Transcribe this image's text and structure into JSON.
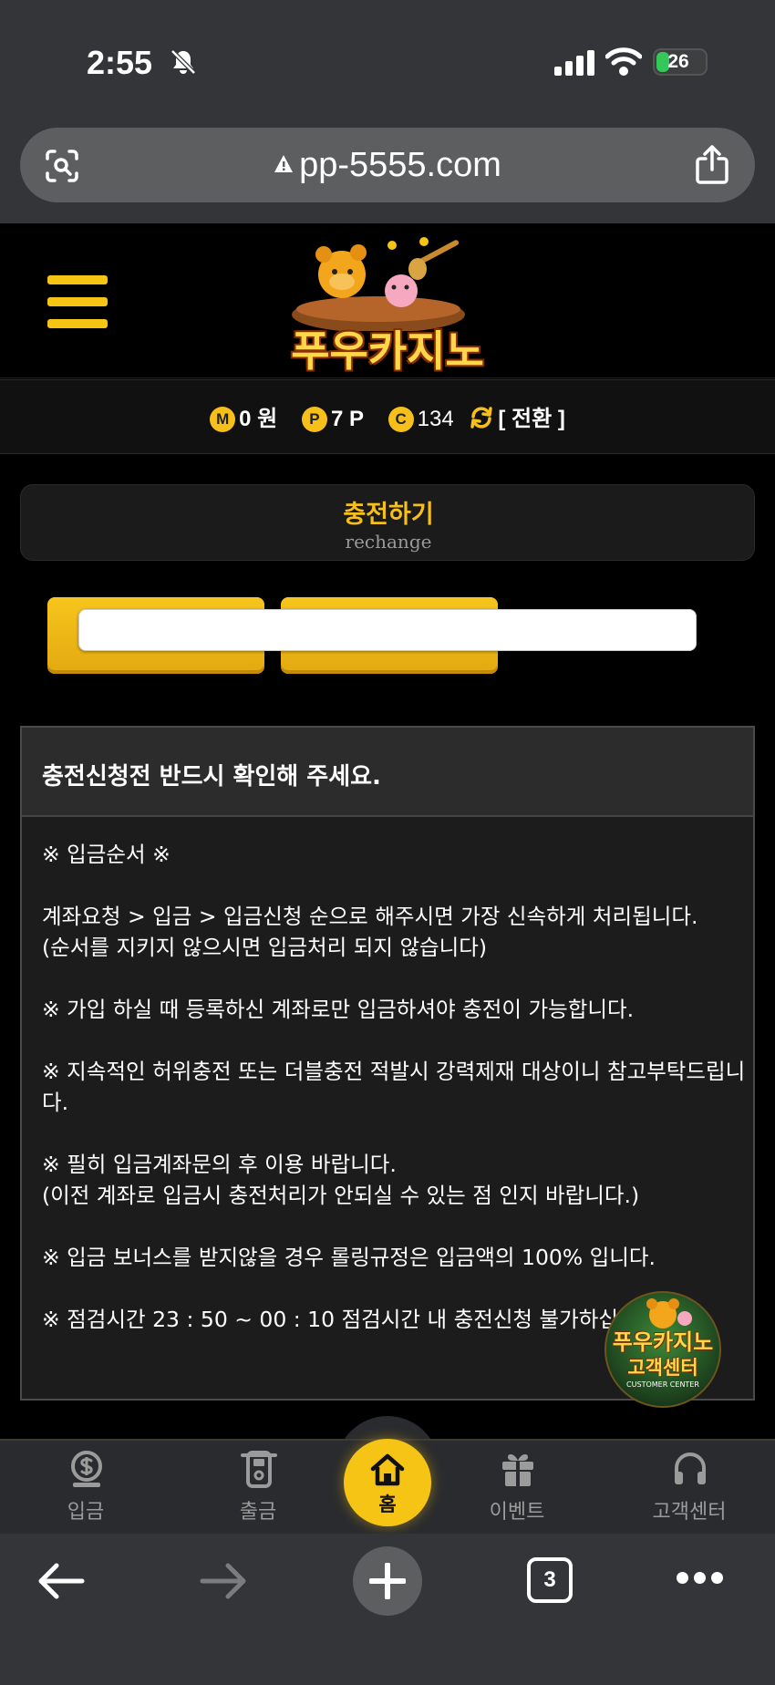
{
  "status": {
    "time": "2:55",
    "battery": "26"
  },
  "browser": {
    "url": "pp-5555.com",
    "tabs_count": "3"
  },
  "site": {
    "logo_text": "푸우카지노"
  },
  "balance": {
    "money_badge": "M",
    "money_value": "0 원",
    "point_badge": "P",
    "point_value": "7 P",
    "coin_badge": "C",
    "coin_value": "134",
    "switch_label": "[ 전환 ]"
  },
  "page": {
    "title": "충전하기",
    "subtitle": "rechange"
  },
  "notice": {
    "heading": "충전신청전 반드시 확인해 주세요.",
    "lines": [
      "※ 입금순서 ※",
      "계좌요청 > 입금 > 입금신청 순으로 해주시면 가장 신속하게 처리됩니다.",
      "(순서를 지키지 않으시면 입금처리 되지 않습니다)",
      "※ 가입 하실 때 등록하신 계좌로만 입금하셔야 충전이 가능합니다.",
      "※ 지속적인 허위충전 또는 더블충전 적발시 강력제재 대상이니 참고부탁드립니",
      "다.",
      "※ 필히 입금계좌문의 후 이용 바랍니다.",
      "(이전 계좌로 입금시 충전처리가 안되실 수 있는 점 인지 바랍니다.)",
      "※ 입금 보너스를 받지않을 경우 롤링규정은 입금액의 100% 입니다.",
      "※ 점검시간 23 : 50 ~ 00 : 10 점검시간 내 충전신청 불가하십니"
    ]
  },
  "customer_center": {
    "line1": "푸우카지노",
    "line2": "고객센터",
    "line3": "CUSTOMER CENTER"
  },
  "bottom_nav": {
    "deposit": "입금",
    "withdraw": "출금",
    "home": "홈",
    "event": "이벤트",
    "support": "고객센터"
  },
  "colors": {
    "accent": "#f6c414",
    "background": "#000000",
    "panel": "#1c1c1c"
  }
}
